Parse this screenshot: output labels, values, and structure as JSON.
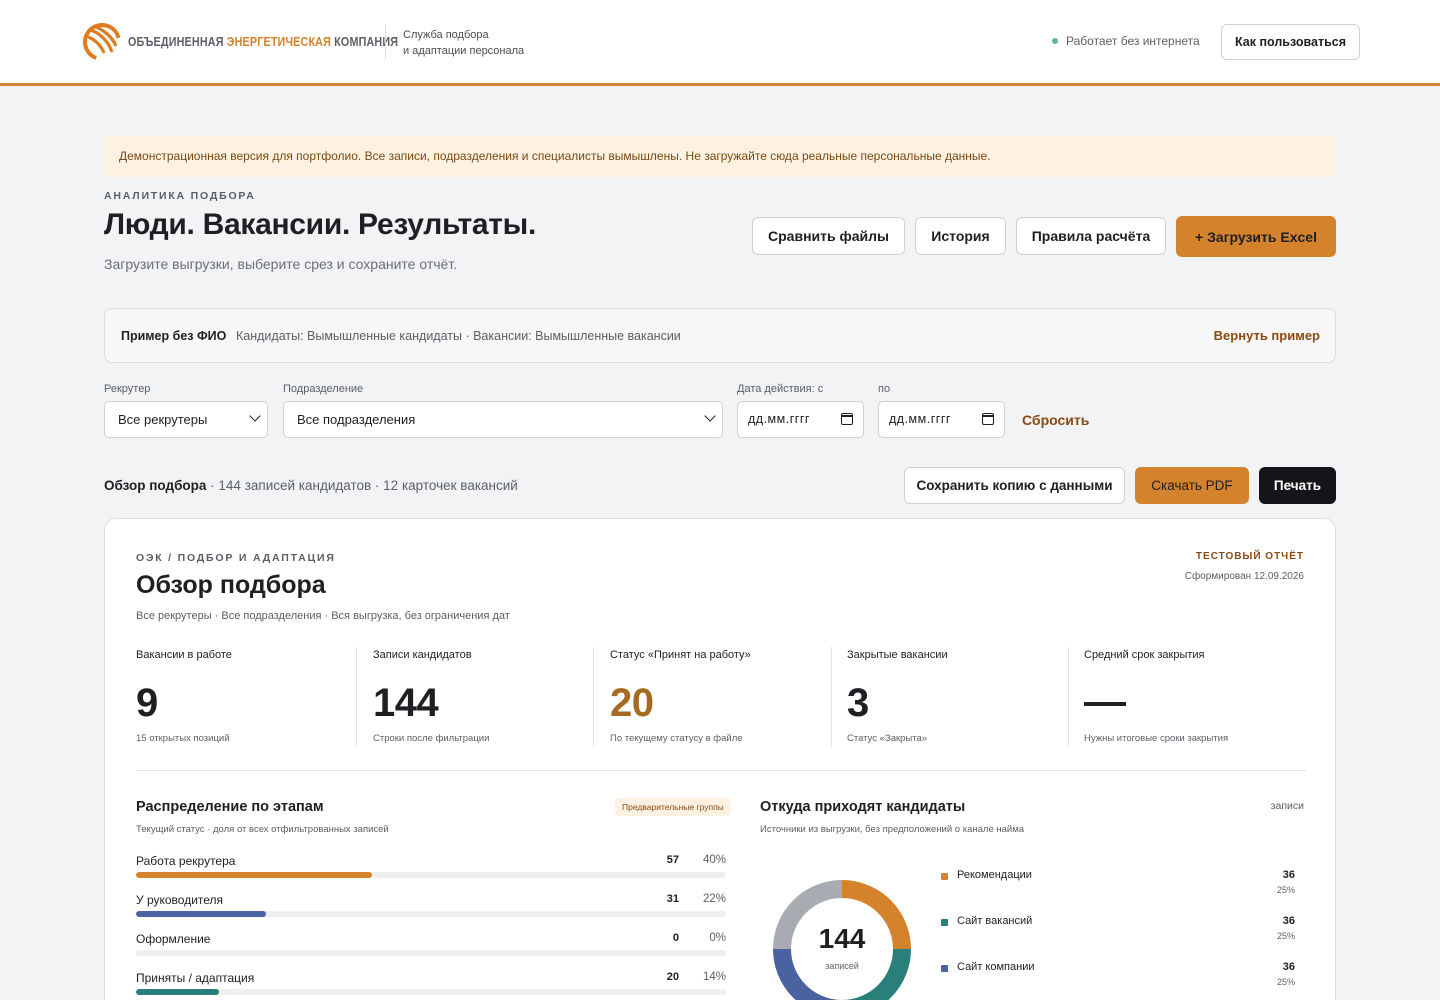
{
  "header": {
    "logo_text_1": "ОБЪЕДИНЕННАЯ ",
    "logo_text_accent": "ЭНЕРГЕТИЧЕСКАЯ",
    "logo_text_2": " КОМПАНИЯ",
    "service_line_1": "Служба подбора",
    "service_line_2": "и адаптации персонала",
    "online_status": "Работает без интернета",
    "help_button": "Как пользоваться"
  },
  "notice": "Демонстрационная версия для портфолио. Все записи, подразделения и специалисты вымышлены. Не загружайте сюда реальные персональные данные.",
  "hero": {
    "eyebrow": "АНАЛИТИКА ПОДБОРА",
    "title": "Люди. Вакансии. Результаты.",
    "subtitle": "Загрузите выгрузки, выберите срез и сохраните отчёт."
  },
  "actions": {
    "compare": "Сравнить файлы",
    "history": "История",
    "rules": "Правила расчёта",
    "upload": "+  Загрузить Excel"
  },
  "sample": {
    "name": "Пример без ФИО",
    "meta": "Кандидаты: Вымышленные кандидаты · Вакансии: Вымышленные вакансии",
    "restore": "Вернуть пример"
  },
  "filters": {
    "recruiter_label": "Рекрутер",
    "recruiter_value": "Все рекрутеры",
    "department_label": "Подразделение",
    "department_value": "Все подразделения",
    "date_from_label": "Дата действия: с",
    "date_from_value": "дд.мм.гггг",
    "date_to_label": "по",
    "date_to_value": "дд.мм.гггг",
    "reset": "Сбросить"
  },
  "overview_bar": {
    "title": "Обзор подбора",
    "meta": " · 144 записей кандидатов · 12 карточек вакансий",
    "save_copy": "Сохранить копию с данными",
    "pdf": "Скачать PDF",
    "print": "Печать"
  },
  "report": {
    "eyebrow": "ОЭК / ПОДБОР И АДАПТАЦИЯ",
    "title": "Обзор подбора",
    "scope": "Все рекрутеры · Все подразделения · Вся выгрузка, без ограничения дат",
    "badge": "ТЕСТОВЫЙ ОТЧЁТ",
    "generated": "Сформирован 12.09.2026",
    "kpis": [
      {
        "label": "Вакансии в работе",
        "value": "9",
        "note": "15 открытых позиций"
      },
      {
        "label": "Записи кандидатов",
        "value": "144",
        "note": "Строки после фильтрации"
      },
      {
        "label": "Статус «Принят на работу»",
        "value": "20",
        "note": "По текущему статусу в файле"
      },
      {
        "label": "Закрытые вакансии",
        "value": "3",
        "note": "Статус «Закрыта»"
      },
      {
        "label": "Средний срок закрытия",
        "value": "",
        "note": "Нужны итоговые сроки закрытия"
      }
    ],
    "stages": {
      "title": "Распределение по этапам",
      "subtitle": "Текущий статус · доля от всех отфильтрованных записей",
      "pill": "Предварительные группы",
      "items": [
        {
          "name": "Работа рекрутера",
          "count": "57",
          "pct": "40%",
          "share": 0.4,
          "color": "#d4822b"
        },
        {
          "name": "У руководителя",
          "count": "31",
          "pct": "22%",
          "share": 0.22,
          "color": "#4a62a0"
        },
        {
          "name": "Оформление",
          "count": "0",
          "pct": "0%",
          "share": 0,
          "color": "#9ea3aa"
        },
        {
          "name": "Приняты / адаптация",
          "count": "20",
          "pct": "14%",
          "share": 0.14,
          "color": "#2a7f7a"
        }
      ]
    },
    "sources": {
      "title": "Откуда приходят кандидаты",
      "subtitle": "Источники из выгрузки, без предположений о канале найма",
      "unit": "записи",
      "total": "144",
      "total_label": "записей",
      "items": [
        {
          "name": "Рекомендации",
          "count": "36",
          "pct": "25%",
          "share": 0.25,
          "color": "#d4822b"
        },
        {
          "name": "Сайт вакансий",
          "count": "36",
          "pct": "25%",
          "share": 0.25,
          "color": "#2a7f7a"
        },
        {
          "name": "Сайт компании",
          "count": "36",
          "pct": "25%",
          "share": 0.25,
          "color": "#4a62a0"
        }
      ],
      "other_color": "#a8acb2",
      "other_share": 0.25
    }
  }
}
